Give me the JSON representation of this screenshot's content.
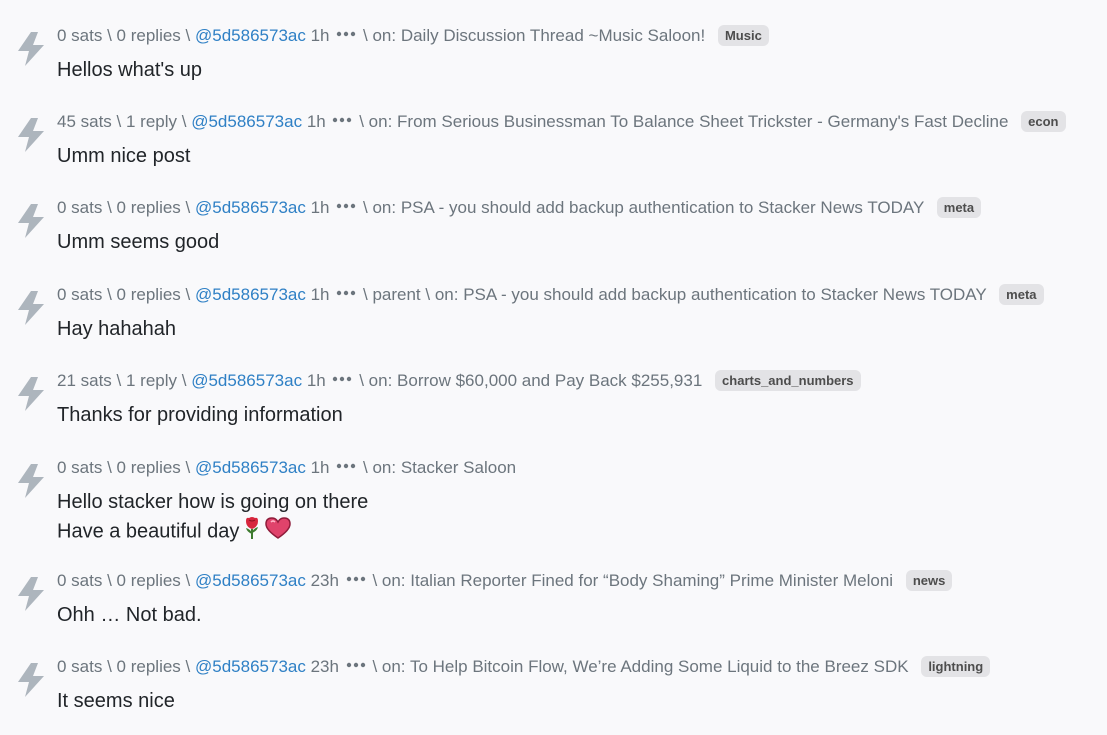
{
  "colors": {
    "background": "#f9f9fb",
    "meta_text": "#6c757d",
    "user_link": "#2f80c5",
    "body_text": "#212529",
    "tag_bg": "#e3e3e6",
    "tag_text": "#4d4d4d",
    "zap_icon": "#adb5bd"
  },
  "icons": {
    "zap": "lightning-bolt-icon",
    "more": "ellipsis-icon",
    "rose": "rose-emoji",
    "heart": "heart-emoji"
  },
  "comments": [
    {
      "sats": "0 sats",
      "replies": "0 replies",
      "user": "@5d586573ac",
      "time": "1h",
      "parent": "",
      "on_label": "on:",
      "title": "Daily Discussion Thread ~Music Saloon!",
      "tag": "Music",
      "body": [
        "Hellos what's up"
      ]
    },
    {
      "sats": "45 sats",
      "replies": "1 reply",
      "user": "@5d586573ac",
      "time": "1h",
      "parent": "",
      "on_label": "on:",
      "title": "From Serious Businessman To Balance Sheet Trickster - Germany's Fast Decline",
      "tag": "econ",
      "body": [
        "Umm nice post"
      ]
    },
    {
      "sats": "0 sats",
      "replies": "0 replies",
      "user": "@5d586573ac",
      "time": "1h",
      "parent": "",
      "on_label": "on:",
      "title": "PSA - you should add backup authentication to Stacker News TODAY",
      "tag": "meta",
      "body": [
        "Umm seems good"
      ]
    },
    {
      "sats": "0 sats",
      "replies": "0 replies",
      "user": "@5d586573ac",
      "time": "1h",
      "parent": "parent",
      "on_label": "on:",
      "title": "PSA - you should add backup authentication to Stacker News TODAY",
      "tag": "meta",
      "body": [
        "Hay hahahah"
      ]
    },
    {
      "sats": "21 sats",
      "replies": "1 reply",
      "user": "@5d586573ac",
      "time": "1h",
      "parent": "",
      "on_label": "on:",
      "title": "Borrow $60,000 and Pay Back $255,931",
      "tag": "charts_and_numbers",
      "body": [
        "Thanks for providing information"
      ]
    },
    {
      "sats": "0 sats",
      "replies": "0 replies",
      "user": "@5d586573ac",
      "time": "1h",
      "parent": "",
      "on_label": "on:",
      "title": "Stacker Saloon",
      "tag": "",
      "body": [
        "Hello stacker how is going on there",
        "Have a beautiful day"
      ]
    },
    {
      "sats": "0 sats",
      "replies": "0 replies",
      "user": "@5d586573ac",
      "time": "23h",
      "parent": "",
      "on_label": "on:",
      "title": "Italian Reporter Fined for “Body Shaming” Prime Minister Meloni",
      "tag": "news",
      "body": [
        "Ohh … Not bad."
      ]
    },
    {
      "sats": "0 sats",
      "replies": "0 replies",
      "user": "@5d586573ac",
      "time": "23h",
      "parent": "",
      "on_label": "on:",
      "title": "To Help Bitcoin Flow, We’re Adding Some Liquid to the Breez SDK",
      "tag": "lightning",
      "body": [
        "It seems nice"
      ]
    }
  ]
}
